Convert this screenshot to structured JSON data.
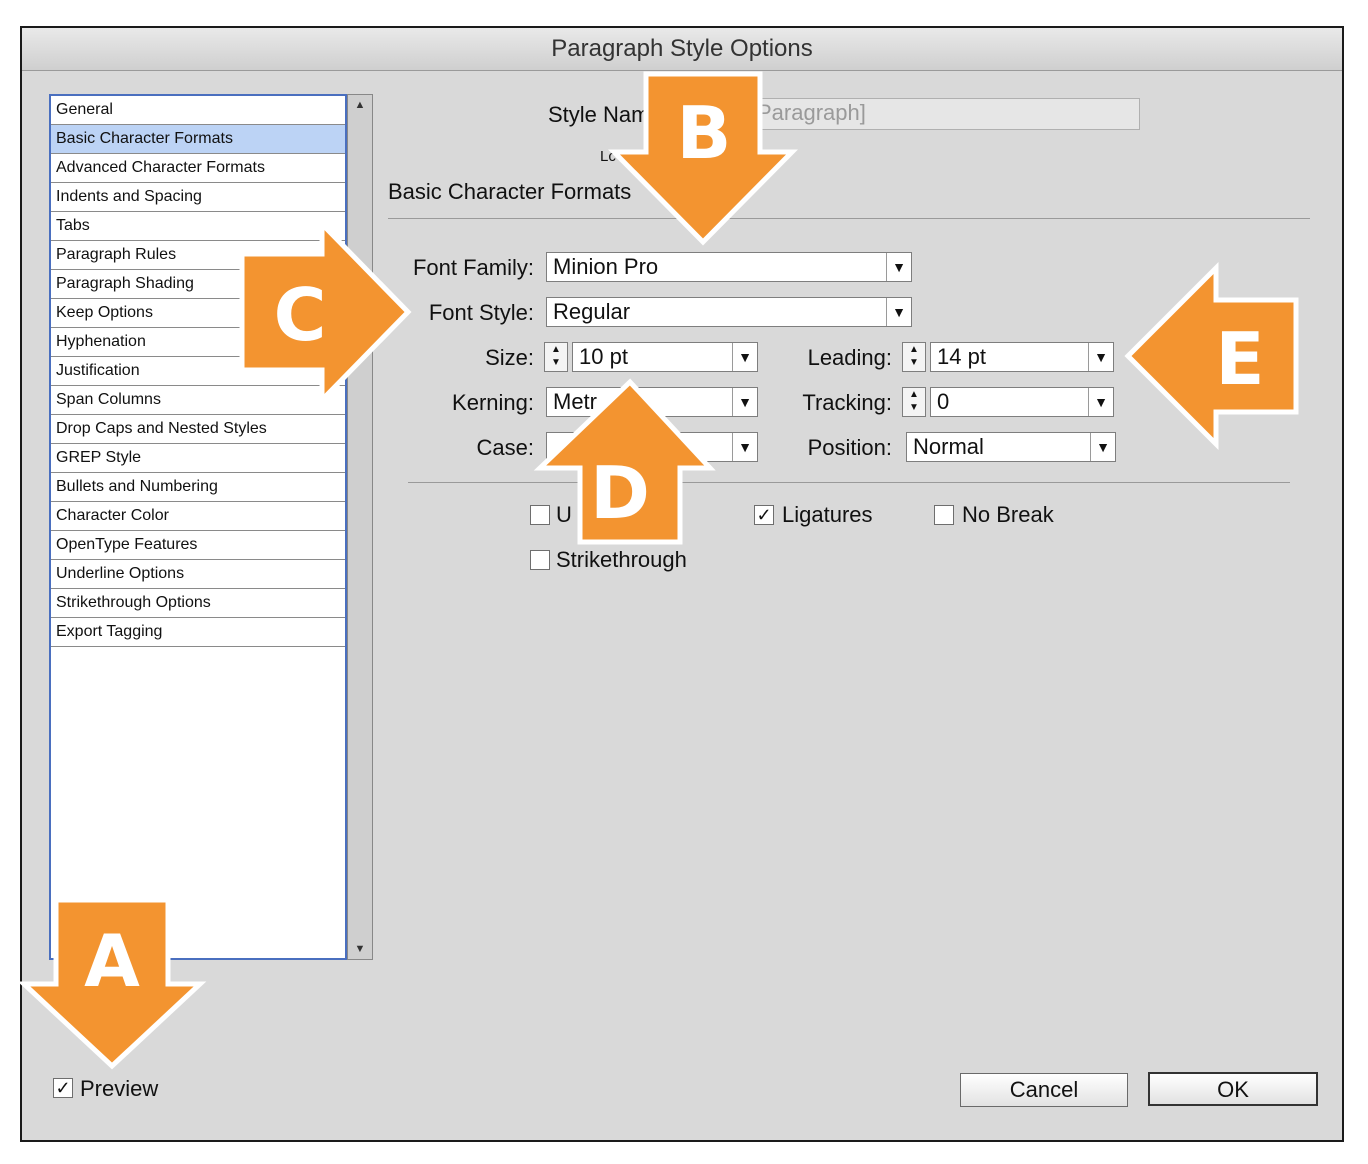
{
  "window": {
    "title": "Paragraph Style Options"
  },
  "sidebar": {
    "items": [
      {
        "label": "General"
      },
      {
        "label": "Basic Character Formats",
        "selected": true
      },
      {
        "label": "Advanced Character Formats"
      },
      {
        "label": "Indents and Spacing"
      },
      {
        "label": "Tabs"
      },
      {
        "label": "Paragraph Rules"
      },
      {
        "label": "Paragraph Shading"
      },
      {
        "label": "Keep Options"
      },
      {
        "label": "Hyphenation"
      },
      {
        "label": "Justification"
      },
      {
        "label": "Span Columns"
      },
      {
        "label": "Drop Caps and Nested Styles"
      },
      {
        "label": "GREP Style"
      },
      {
        "label": "Bullets and Numbering"
      },
      {
        "label": "Character Color"
      },
      {
        "label": "OpenType Features"
      },
      {
        "label": "Underline Options"
      },
      {
        "label": "Strikethrough Options"
      },
      {
        "label": "Export Tagging"
      }
    ]
  },
  "header": {
    "style_name_label": "Style Nam",
    "style_name_value": "Paragraph]",
    "location_label": "Lc",
    "section_title": "Basic Character Formats"
  },
  "form": {
    "font_family_label": "Font Family:",
    "font_family_value": "Minion Pro",
    "font_style_label": "Font Style:",
    "font_style_value": "Regular",
    "size_label": "Size:",
    "size_value": "10 pt",
    "leading_label": "Leading:",
    "leading_value": "14 pt",
    "kerning_label": "Kerning:",
    "kerning_value": "Metr",
    "tracking_label": "Tracking:",
    "tracking_value": "0",
    "case_label": "Case:",
    "case_value": "",
    "position_label": "Position:",
    "position_value": "Normal"
  },
  "checkboxes": {
    "underline_label": "U",
    "underline_checked": false,
    "ligatures_label": "Ligatures",
    "ligatures_checked": true,
    "nobreak_label": "No Break",
    "nobreak_checked": false,
    "strikethrough_label": "Strikethrough",
    "strikethrough_checked": false
  },
  "footer": {
    "preview_label": "Preview",
    "preview_checked": true,
    "cancel_label": "Cancel",
    "ok_label": "OK"
  },
  "callouts": {
    "a": "A",
    "b": "B",
    "c": "C",
    "d": "D",
    "e": "E",
    "color": "#f39430"
  },
  "icons": {
    "check": "✓",
    "dropdown": "▼",
    "stepper": "▲▼"
  }
}
